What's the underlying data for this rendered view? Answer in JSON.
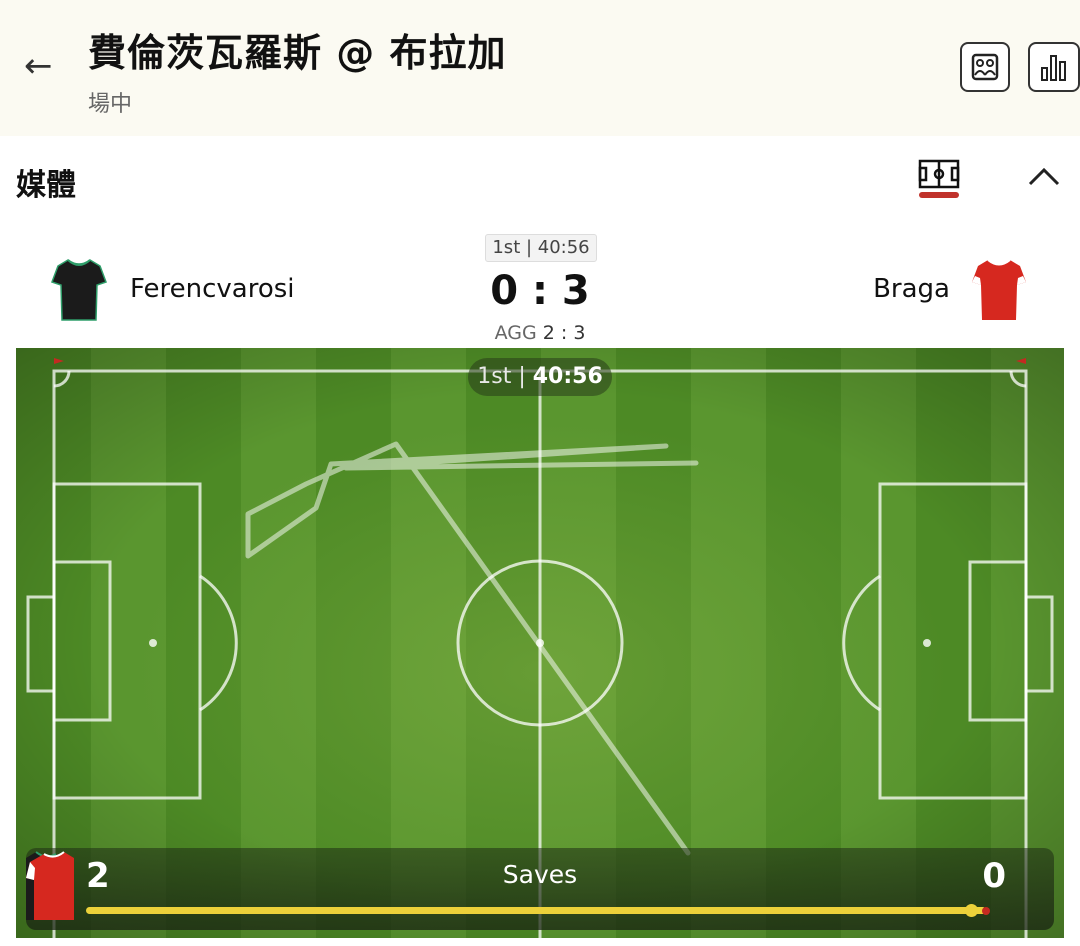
{
  "header": {
    "back_icon": "arrow-left-icon",
    "title": "費倫茨瓦羅斯 @ 布拉加",
    "subtitle": "場中",
    "buttons": [
      {
        "icon": "lineup-icon"
      },
      {
        "icon": "stats-bars-icon"
      }
    ]
  },
  "media": {
    "title": "媒體",
    "pitch_toggle_icon": "pitch-icon",
    "collapse_icon": "chevron-up-icon",
    "accent_color": "#c0322b"
  },
  "match": {
    "period_clock": "1st | 40:56",
    "home_team": "Ferencvarosi",
    "away_team": "Braga",
    "score": "0 : 3",
    "agg_label": "AGG",
    "agg_score": "2 : 3",
    "home_kit_color": "#1b1b1b",
    "home_kit_trim": "#2f9e6a",
    "away_kit_color": "#d6281f"
  },
  "pitch": {
    "period": "1st",
    "clock": "40:56",
    "grass_dark": "#4d8a25",
    "grass_light": "#5a962f"
  },
  "stat": {
    "label": "Saves",
    "home_value": "2",
    "away_value": "0",
    "home_share": 1.0,
    "bar_color": "#ecd13a"
  }
}
